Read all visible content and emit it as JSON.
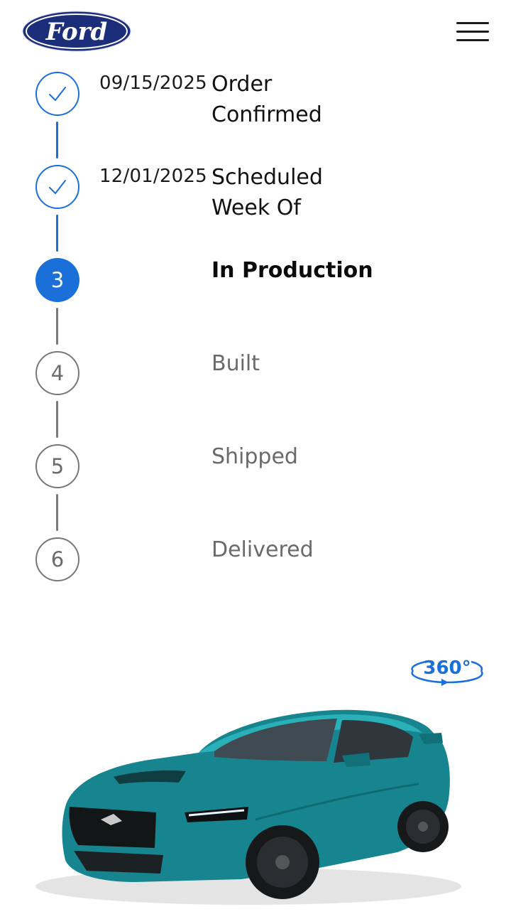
{
  "header": {
    "logo_text": "Ford",
    "menu_icon": "hamburger-menu-icon",
    "brand_color": "#1c2d7a"
  },
  "tracker": {
    "accent": "#1a6fd9",
    "steps": [
      {
        "number": "1",
        "date": "09/15/2025",
        "line1": "Order",
        "line2": "Confirmed",
        "status": "done",
        "icon": "check-icon"
      },
      {
        "number": "2",
        "date": "12/01/2025",
        "line1": "Scheduled",
        "line2": "Week Of",
        "status": "done",
        "icon": "check-icon"
      },
      {
        "number": "3",
        "label": "In Production",
        "status": "current"
      },
      {
        "number": "4",
        "label": "Built",
        "status": "pending"
      },
      {
        "number": "5",
        "label": "Shipped",
        "status": "pending"
      },
      {
        "number": "6",
        "label": "Delivered",
        "status": "pending"
      }
    ]
  },
  "vehicle": {
    "view_360_label": "360°",
    "color": "#1a8a94"
  }
}
